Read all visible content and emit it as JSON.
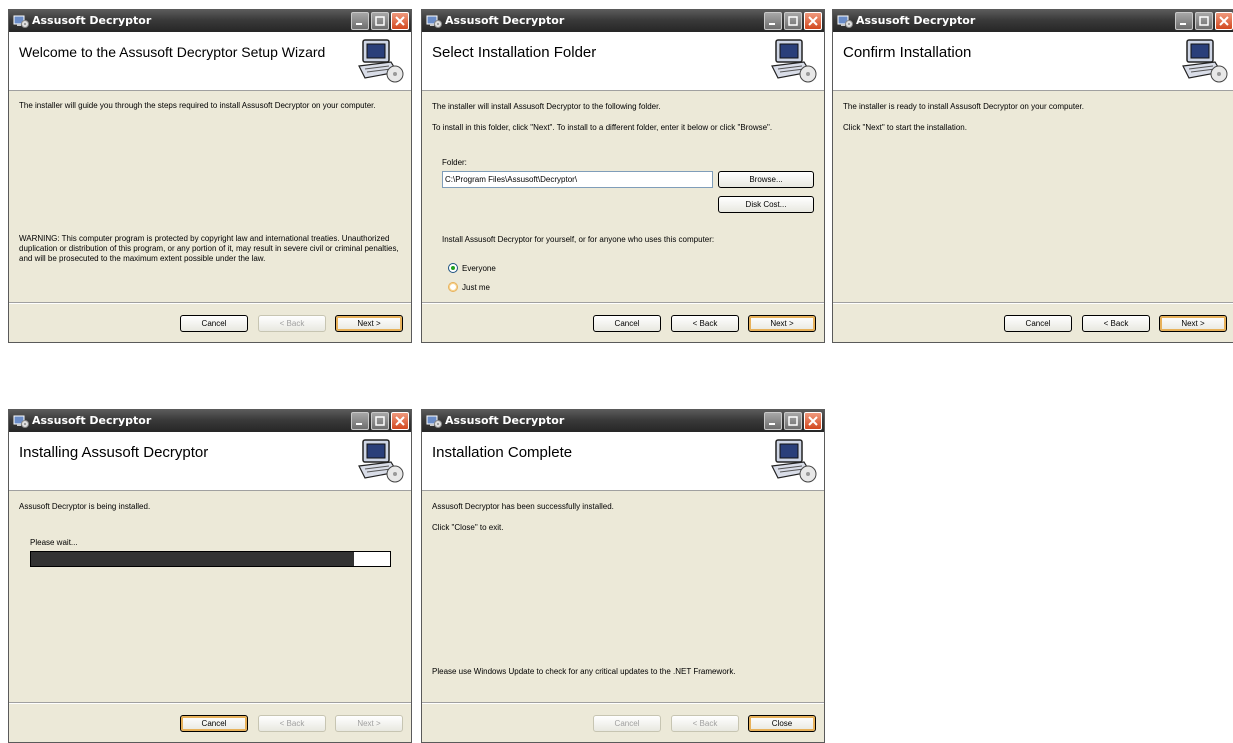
{
  "app": {
    "title": "Assusoft Decryptor"
  },
  "buttons": {
    "cancel": "Cancel",
    "back": "< Back",
    "next": "Next >",
    "close": "Close"
  },
  "welcome": {
    "header": "Welcome to the Assusoft Decryptor Setup Wizard",
    "intro": "The installer will guide you through the steps required to install Assusoft Decryptor on your computer.",
    "warning": "WARNING: This computer program is protected by copyright law and international treaties. Unauthorized duplication or distribution of this program, or any portion of it, may result in severe civil or criminal penalties, and will be prosecuted to the maximum extent possible under the law."
  },
  "folder": {
    "header": "Select Installation Folder",
    "line1": "The installer will install Assusoft Decryptor to the following folder.",
    "line2": "To install in this folder, click \"Next\". To install to a different folder, enter it below or click \"Browse\".",
    "folder_label": "Folder:",
    "folder_value": "C:\\Program Files\\Assusoft\\Decryptor\\",
    "browse_label": "Browse...",
    "disk_cost_label": "Disk Cost...",
    "question": "Install Assusoft Decryptor for yourself, or for anyone who uses this computer:",
    "options": [
      {
        "label": "Everyone",
        "checked": true
      },
      {
        "label": "Just me",
        "checked": false
      }
    ]
  },
  "confirm": {
    "header": "Confirm Installation",
    "line1": "The installer is ready to install Assusoft Decryptor on your computer.",
    "line2": "Click \"Next\" to start the installation."
  },
  "installing": {
    "header": "Installing Assusoft Decryptor",
    "line1": "Assusoft Decryptor is being installed.",
    "wait": "Please wait...",
    "progress": 0.9
  },
  "complete": {
    "header": "Installation Complete",
    "line1": "Assusoft Decryptor has been successfully installed.",
    "line2": "Click \"Close\" to exit.",
    "note": "Please use Windows Update to check for any critical updates to the .NET Framework."
  },
  "icons": [
    "app-installer-icon",
    "minimize-icon",
    "maximize-icon",
    "close-icon",
    "computer-cd-icon"
  ],
  "colors": {
    "titlebar": "#3a3a3a",
    "dialog_bg": "#ece9d8",
    "default_button_focus": "#e7b15a",
    "close_button": "#d2481f",
    "progress_fill": "#333333"
  }
}
